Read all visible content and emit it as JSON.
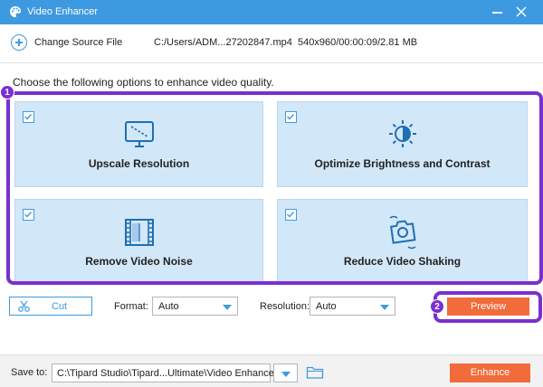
{
  "window": {
    "title": "Video Enhancer"
  },
  "source": {
    "change_label": "Change Source File",
    "path": "C:/Users/ADM...27202847.mp4",
    "meta": "540x960/00:00:09/2.81 MB"
  },
  "instruction": "Choose the following options to enhance video quality.",
  "options": [
    {
      "label": "Upscale Resolution",
      "checked": true,
      "icon": "monitor-icon"
    },
    {
      "label": "Optimize Brightness and Contrast",
      "checked": true,
      "icon": "brightness-icon"
    },
    {
      "label": "Remove Video Noise",
      "checked": true,
      "icon": "film-icon"
    },
    {
      "label": "Reduce Video Shaking",
      "checked": true,
      "icon": "camera-shake-icon"
    }
  ],
  "controls": {
    "cut_label": "Cut",
    "format_label": "Format:",
    "format_value": "Auto",
    "resolution_label": "Resolution:",
    "resolution_value": "Auto",
    "preview_label": "Preview"
  },
  "annotations": {
    "badge1": "1",
    "badge2": "2"
  },
  "footer": {
    "save_label": "Save to:",
    "save_path": "C:\\Tipard Studio\\Tipard...Ultimate\\Video Enhancer",
    "enhance_label": "Enhance"
  },
  "colors": {
    "accent": "#3e9ae0",
    "card_bg": "#d2e7f8",
    "action": "#f26b3a",
    "highlight": "#7a2fd0"
  }
}
